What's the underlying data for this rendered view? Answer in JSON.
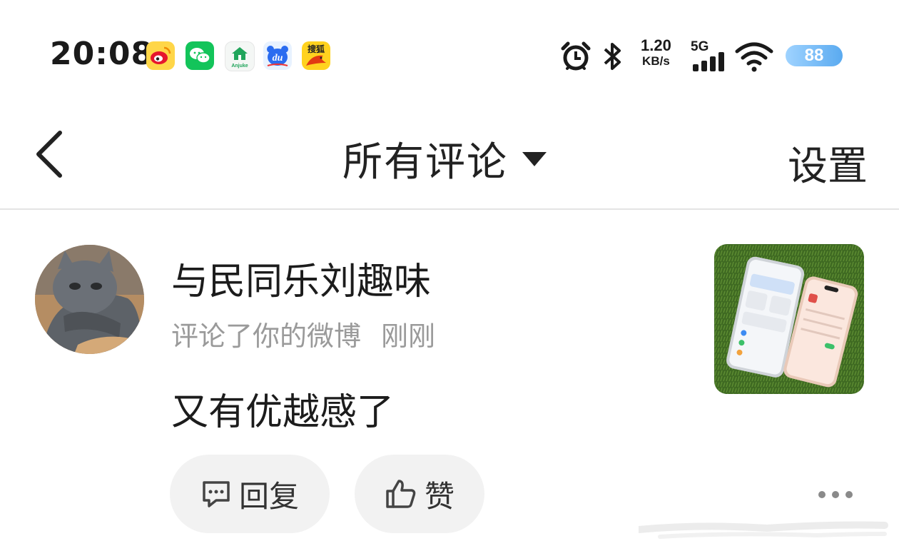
{
  "status_bar": {
    "time": "20:08",
    "app_icons": [
      "weibo-icon",
      "wechat-icon",
      "anjuke-icon",
      "baidu-du-icon",
      "sohu-icon"
    ],
    "anjuke_label": "Anjuke",
    "du_label": "du",
    "sohu_label": "搜狐",
    "net_speed_value": "1.20",
    "net_speed_unit": "KB/s",
    "network_type": "5G",
    "battery_level": "88",
    "icons": [
      "alarm-icon",
      "bluetooth-icon",
      "signal-icon",
      "wifi-icon",
      "battery-icon"
    ]
  },
  "nav": {
    "title": "所有评论",
    "settings_label": "设置",
    "icons": [
      "back-chevron-icon",
      "caret-down-icon"
    ]
  },
  "comment": {
    "username": "与民同乐刘趣味",
    "action": "评论了你的微博",
    "time": "刚刚",
    "text": "又有优越感了",
    "reply_label": "回复",
    "like_label": "赞",
    "icons": [
      "reply-bubble-icon",
      "thumbs-up-icon",
      "more-dots-icon"
    ]
  },
  "colors": {
    "text_primary": "#222222",
    "text_secondary": "#9a9a9a",
    "pill_bg": "#f2f2f2",
    "battery": "#5aaaf0",
    "divider": "#e4e4e4"
  }
}
